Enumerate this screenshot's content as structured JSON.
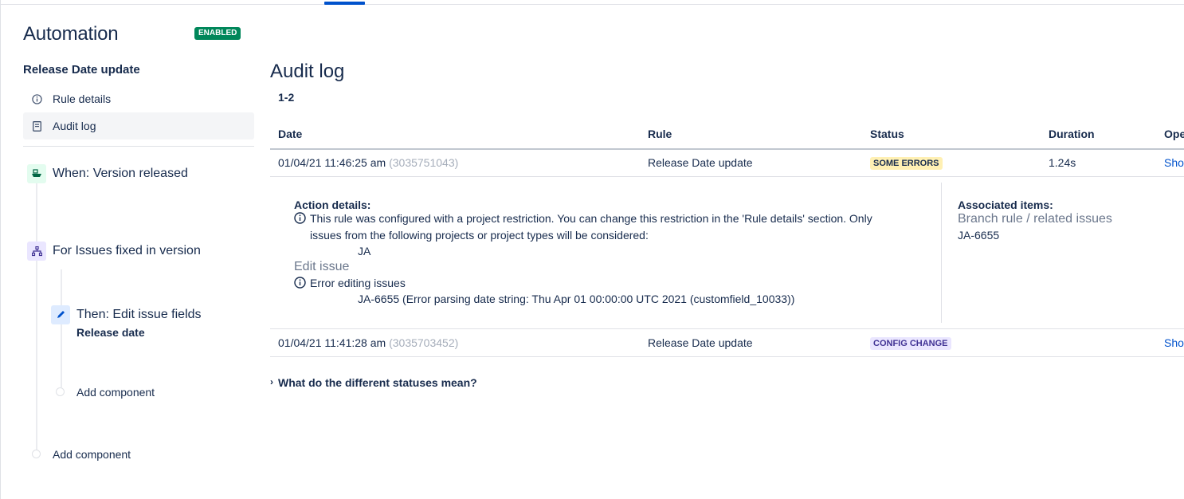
{
  "sidebar": {
    "app_title": "Automation",
    "status_lozenge": "ENABLED",
    "rule_name": "Release Date update",
    "nav": [
      {
        "label": "Rule details",
        "icon": "info-icon"
      },
      {
        "label": "Audit log",
        "icon": "document-icon"
      }
    ],
    "components": {
      "trigger": {
        "label": "When: Version released",
        "icon": "ship-icon"
      },
      "branch": {
        "label": "For Issues fixed in version",
        "icon": "branch-icon"
      },
      "action": {
        "label": "Then: Edit issue fields",
        "sub": "Release date",
        "icon": "pencil-icon"
      },
      "add_inner": "Add component",
      "add_outer": "Add component"
    }
  },
  "main": {
    "title": "Audit log",
    "range": "1-2",
    "columns": [
      "Date",
      "Rule",
      "Status",
      "Duration",
      "Ope"
    ],
    "rows": [
      {
        "date": "01/04/21 11:46:25 am",
        "id": "(3035751043)",
        "rule": "Release Date update",
        "status": "SOME ERRORS",
        "duration": "1.24s",
        "action": "Sho"
      },
      {
        "date": "01/04/21 11:41:28 am",
        "id": "(3035703452)",
        "rule": "Release Date update",
        "status": "CONFIG CHANGE",
        "duration": "",
        "action": "Sho"
      }
    ],
    "details": {
      "heading": "Action details:",
      "restriction_line1": "This rule was configured with a project restriction. You can change this restriction in the 'Rule details' section. Only",
      "restriction_line2": "issues from the following projects or project types will be considered:",
      "project": "JA",
      "edit_issue": "Edit issue",
      "error_label": "Error editing issues",
      "error_detail": "JA-6655 (Error parsing date string: Thu Apr 01 00:00:00 UTC 2021 (customfield_10033))",
      "associated_heading": "Associated items:",
      "associated_type": "Branch rule / related issues",
      "associated_issue": "JA-6655"
    },
    "faq": "What do the different statuses mean?"
  },
  "colors": {
    "enabled": "#00875a",
    "some_errors_bg": "#fff0b3",
    "config_change_bg": "#eae6ff",
    "config_change_fg": "#403294",
    "link": "#0052cc",
    "tab_indicator": "#0052cc"
  }
}
